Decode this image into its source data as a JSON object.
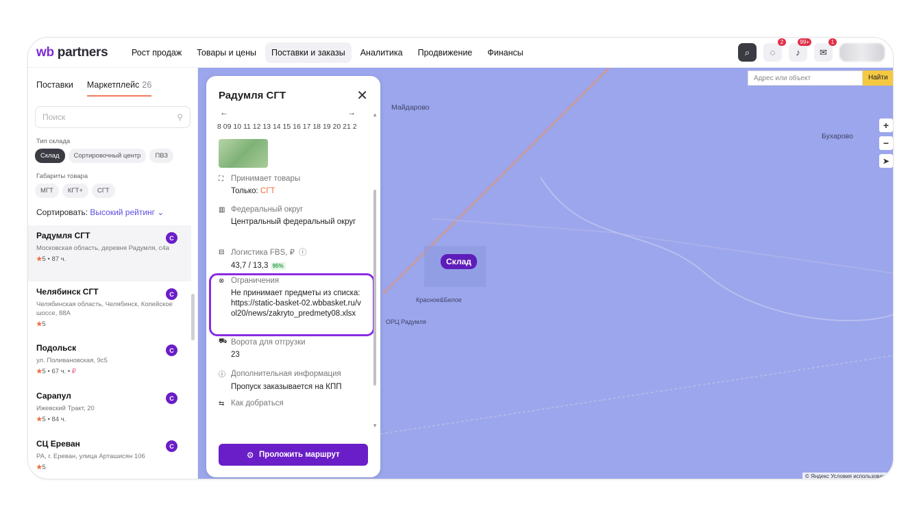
{
  "app": {
    "logo_a": "wb",
    "logo_b": " partners"
  },
  "nav": [
    "Рост продаж",
    "Товары и цены",
    "Поставки и заказы",
    "Аналитика",
    "Продвижение",
    "Финансы"
  ],
  "nav_active": 2,
  "topbar": {
    "badges": [
      "2",
      "99+",
      "1"
    ]
  },
  "sidebar": {
    "tabs": [
      {
        "label": "Поставки"
      },
      {
        "label": "Маркетплейс",
        "count": "26"
      }
    ],
    "search_placeholder": "Поиск",
    "warehouse_type_label": "Тип склада",
    "warehouse_types": [
      "Склад",
      "Сортировочный центр",
      "ПВЗ"
    ],
    "dimensions_label": "Габариты товара",
    "dimensions": [
      "МГТ",
      "КГТ+",
      "СГТ"
    ],
    "sort_label": "Сортировать:",
    "sort_value": "Высокий рейтинг",
    "items": [
      {
        "title": "Радумля СГТ",
        "address": "Московская область, деревня Радумля, с4а",
        "rating": "5",
        "hours": "87 ч.",
        "badge": "С"
      },
      {
        "title": "Челябинск СГТ",
        "address": "Челябинская область, Челябинск, Копейское шоссе, 88А",
        "rating": "5",
        "hours": "",
        "badge": "С"
      },
      {
        "title": "Подольск",
        "address": "ул. Поливановская, 9с5",
        "rating": "5",
        "hours": "67 ч.",
        "badge": "С"
      },
      {
        "title": "Сарапул",
        "address": "Ижевский Тракт, 20",
        "rating": "5",
        "hours": "84 ч.",
        "badge": "С"
      },
      {
        "title": "СЦ Ереван",
        "address": "РА, г. Ереван, улица Арташисян 106",
        "rating": "5",
        "hours": "",
        "badge": "С"
      }
    ]
  },
  "map": {
    "search_placeholder": "Адрес или объект",
    "search_button": "Найти",
    "labels": [
      "Майдарово",
      "Бухарово",
      "Склад",
      "Красное&Белое",
      "ОРЦ Радумля"
    ],
    "copyright": "© Яндекс Условия использования"
  },
  "panel": {
    "title": "Радумля СГТ",
    "dates": "8 09 10 11 12 13 14 15 16 17 18 19 20 21 2",
    "sections": [
      {
        "head": "Принимает товары",
        "value_prefix": "Только: ",
        "value_accent": "СГТ"
      },
      {
        "head": "Федеральный округ",
        "value": "Центральный федеральный округ"
      },
      {
        "head": "Логистика FBS, ₽",
        "value": "43,7 / 13,3",
        "pct": "95%"
      },
      {
        "head": "Ограничения",
        "value": "Не принимает предметы из списка: https://static-basket-02.wbbasket.ru/vol20/news/zakryto_predmety08.xlsx"
      },
      {
        "head": "Ворота для отгрузки",
        "value": "23"
      },
      {
        "head": "Дополнительная информация",
        "value": "Пропуск заказывается на КПП"
      },
      {
        "head": "Как добраться"
      }
    ],
    "route_button": "Проложить маршрут"
  }
}
